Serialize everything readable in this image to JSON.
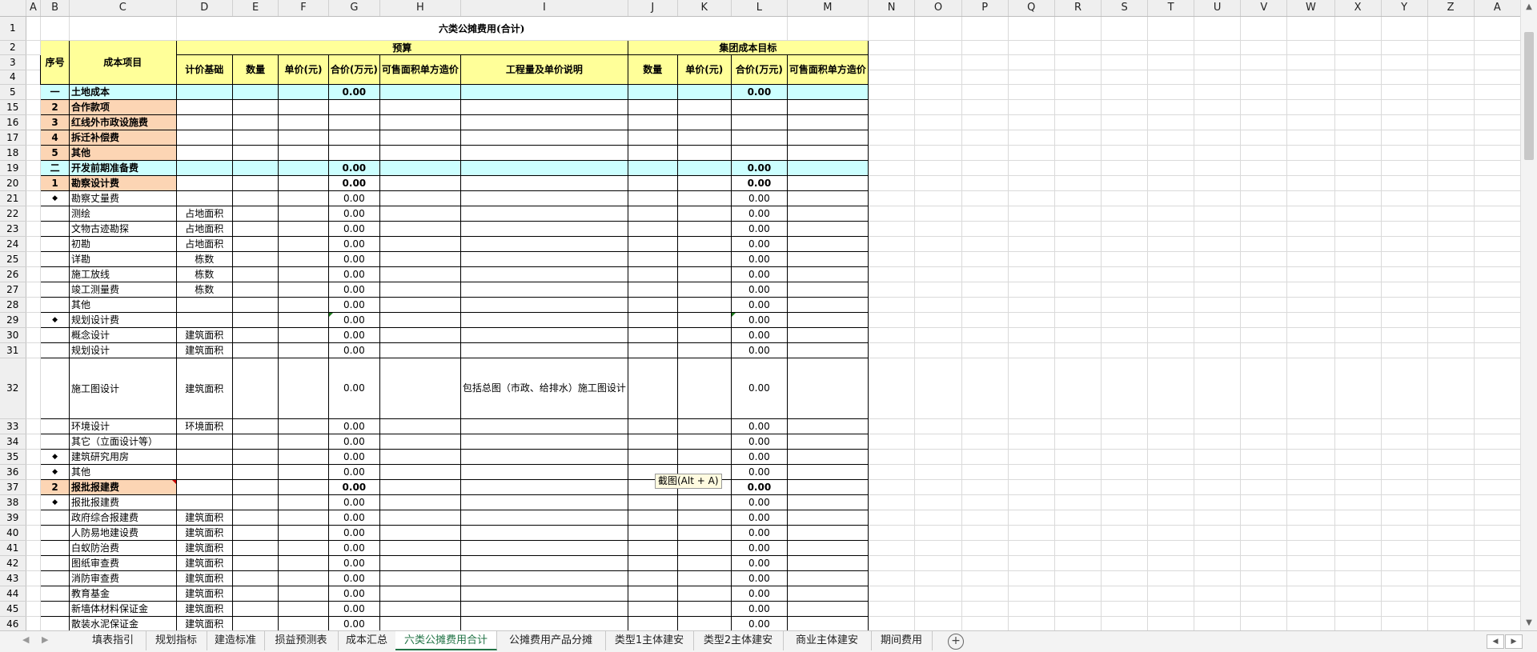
{
  "columns": [
    "A",
    "B",
    "C",
    "D",
    "E",
    "F",
    "G",
    "H",
    "I",
    "J",
    "K",
    "L",
    "M",
    "N",
    "O",
    "P",
    "Q",
    "R",
    "S",
    "T",
    "U",
    "V",
    "W",
    "X",
    "Y",
    "Z",
    "A"
  ],
  "title": "六类公摊费用(合计)",
  "headers": {
    "seq": "序号",
    "item": "成本项目",
    "budget": "预算",
    "group_target": "集团成本目标",
    "basis": "计价基础",
    "qty": "数量",
    "unit_price": "单价(元)",
    "total": "合价(万元)",
    "per_area": "可售面积单方造价",
    "desc": "工程量及单价说明",
    "qty2": "数量",
    "unit_price2": "单价(元)",
    "total2": "合价(万元)",
    "per_area2": "可售面积单方造价"
  },
  "header_rows": [
    "1",
    "2",
    "3",
    "4"
  ],
  "rows": [
    {
      "r": "5",
      "b": "一",
      "c": "土地成本",
      "d": "",
      "g": "0.00",
      "i": "",
      "l": "0.00",
      "type": "section"
    },
    {
      "r": "15",
      "b": "2",
      "c": "合作款项",
      "d": "",
      "g": "",
      "i": "",
      "l": "",
      "type": "cat"
    },
    {
      "r": "16",
      "b": "3",
      "c": "红线外市政设施费",
      "d": "",
      "g": "",
      "i": "",
      "l": "",
      "type": "cat"
    },
    {
      "r": "17",
      "b": "4",
      "c": "拆迁补偿费",
      "d": "",
      "g": "",
      "i": "",
      "l": "",
      "type": "cat"
    },
    {
      "r": "18",
      "b": "5",
      "c": "其他",
      "d": "",
      "g": "",
      "i": "",
      "l": "",
      "type": "cat"
    },
    {
      "r": "19",
      "b": "二",
      "c": "开发前期准备费",
      "d": "",
      "g": "0.00",
      "i": "",
      "l": "0.00",
      "type": "section"
    },
    {
      "r": "20",
      "b": "1",
      "c": "勘察设计费",
      "d": "",
      "g": "0.00",
      "i": "",
      "l": "0.00",
      "type": "cat"
    },
    {
      "r": "21",
      "b": "◆",
      "c": "勘察丈量费",
      "d": "",
      "g": "0.00",
      "i": "",
      "l": "0.00",
      "type": "sub"
    },
    {
      "r": "22",
      "b": "",
      "c": "测绘",
      "d": "占地面积",
      "g": "0.00",
      "i": "",
      "l": "0.00",
      "type": "item"
    },
    {
      "r": "23",
      "b": "",
      "c": "文物古迹勘探",
      "d": "占地面积",
      "g": "0.00",
      "i": "",
      "l": "0.00",
      "type": "item"
    },
    {
      "r": "24",
      "b": "",
      "c": "初勘",
      "d": "占地面积",
      "g": "0.00",
      "i": "",
      "l": "0.00",
      "type": "item"
    },
    {
      "r": "25",
      "b": "",
      "c": "详勘",
      "d": "栋数",
      "g": "0.00",
      "i": "",
      "l": "0.00",
      "type": "item"
    },
    {
      "r": "26",
      "b": "",
      "c": "施工放线",
      "d": "栋数",
      "g": "0.00",
      "i": "",
      "l": "0.00",
      "type": "item"
    },
    {
      "r": "27",
      "b": "",
      "c": "竣工测量费",
      "d": "栋数",
      "g": "0.00",
      "i": "",
      "l": "0.00",
      "type": "item"
    },
    {
      "r": "28",
      "b": "",
      "c": "其他",
      "d": "",
      "g": "0.00",
      "i": "",
      "l": "0.00",
      "type": "item2"
    },
    {
      "r": "29",
      "b": "◆",
      "c": "规划设计费",
      "d": "",
      "g": "0.00",
      "i": "",
      "l": "0.00",
      "type": "sub",
      "mark": true
    },
    {
      "r": "30",
      "b": "",
      "c": "概念设计",
      "d": "建筑面积",
      "g": "0.00",
      "i": "",
      "l": "0.00",
      "type": "item"
    },
    {
      "r": "31",
      "b": "",
      "c": "规划设计",
      "d": "建筑面积",
      "g": "0.00",
      "i": "",
      "l": "0.00",
      "type": "item"
    },
    {
      "r": "32",
      "b": "",
      "c": "施工图设计",
      "d": "建筑面积",
      "g": "0.00",
      "i": "包括总图（市政、给排水）施工图设计",
      "l": "0.00",
      "type": "item",
      "tall": true
    },
    {
      "r": "33",
      "b": "",
      "c": "环境设计",
      "d": "环境面积",
      "g": "0.00",
      "i": "",
      "l": "0.00",
      "type": "item"
    },
    {
      "r": "34",
      "b": "",
      "c": "其它（立面设计等）",
      "d": "",
      "g": "0.00",
      "i": "",
      "l": "0.00",
      "type": "item"
    },
    {
      "r": "35",
      "b": "◆",
      "c": "建筑研究用房",
      "d": "",
      "g": "0.00",
      "i": "",
      "l": "0.00",
      "type": "sub"
    },
    {
      "r": "36",
      "b": "◆",
      "c": "其他",
      "d": "",
      "g": "0.00",
      "i": "",
      "l": "0.00",
      "type": "sub"
    },
    {
      "r": "37",
      "b": "2",
      "c": "报批报建费",
      "d": "",
      "g": "0.00",
      "i": "",
      "l": "0.00",
      "type": "cat",
      "redmark": true
    },
    {
      "r": "38",
      "b": "◆",
      "c": "报批报建费",
      "d": "",
      "g": "0.00",
      "i": "",
      "l": "0.00",
      "type": "sub"
    },
    {
      "r": "39",
      "b": "",
      "c": "政府综合报建费",
      "d": "建筑面积",
      "g": "0.00",
      "i": "",
      "l": "0.00",
      "type": "item"
    },
    {
      "r": "40",
      "b": "",
      "c": "人防易地建设费",
      "d": "建筑面积",
      "g": "0.00",
      "i": "",
      "l": "0.00",
      "type": "item"
    },
    {
      "r": "41",
      "b": "",
      "c": "白蚁防治费",
      "d": "建筑面积",
      "g": "0.00",
      "i": "",
      "l": "0.00",
      "type": "item"
    },
    {
      "r": "42",
      "b": "",
      "c": "图纸审查费",
      "d": "建筑面积",
      "g": "0.00",
      "i": "",
      "l": "0.00",
      "type": "item"
    },
    {
      "r": "43",
      "b": "",
      "c": "消防审查费",
      "d": "建筑面积",
      "g": "0.00",
      "i": "",
      "l": "0.00",
      "type": "item"
    },
    {
      "r": "44",
      "b": "",
      "c": "教育基金",
      "d": "建筑面积",
      "g": "0.00",
      "i": "",
      "l": "0.00",
      "type": "item"
    },
    {
      "r": "45",
      "b": "",
      "c": "新墙体材料保证金",
      "d": "建筑面积",
      "g": "0.00",
      "i": "",
      "l": "0.00",
      "type": "item"
    },
    {
      "r": "46",
      "b": "",
      "c": "散装水泥保证金",
      "d": "建筑面积",
      "g": "0.00",
      "i": "",
      "l": "0.00",
      "type": "item"
    }
  ],
  "tooltip": "截图(Alt + A)",
  "tabs": [
    "填表指引",
    "规划指标",
    "建造标准",
    "损益预测表",
    "成本汇总",
    "六类公摊费用合计",
    "公摊费用产品分摊",
    "类型1主体建安",
    "类型2主体建安",
    "商业主体建安",
    "期间费用"
  ],
  "active_tab": "六类公摊费用合计",
  "colors": {
    "accent": "#217346",
    "section_bg": "#ccffff",
    "category_bg": "#fcd5b4",
    "header_bg": "#ffff99",
    "title": "#c0392b"
  }
}
